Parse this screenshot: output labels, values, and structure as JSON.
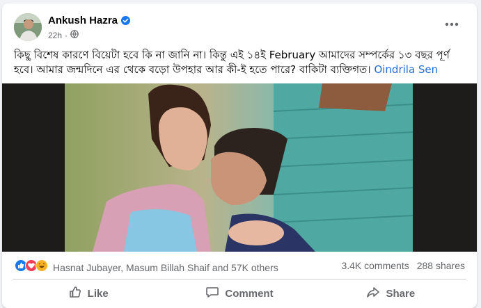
{
  "post": {
    "author": "Ankush Hazra",
    "time": "22h",
    "caption_text": "কিছু বিশেষ কারণে বিয়েটা হবে কি না জানি না। কিন্তু এই ১৪ই February আমাদের সম্পর্কের ১৩ বছর পূর্ণ হবে। আমার জন্মদিনে এর থেকে বড়ো উপহার আর কী-ই হতে পারে? বাকিটা ব্যক্তিগত।",
    "tagged": "Oindrila Sen"
  },
  "stats": {
    "reactors": "Hasnat Jubayer, Masum Billah Shaif and 57K others",
    "comments": "3.4K comments",
    "shares": "288 shares"
  },
  "actions": {
    "like": "Like",
    "comment": "Comment",
    "share": "Share"
  },
  "colors": {
    "link": "#216fdb",
    "like_blue": "#1877f2",
    "love_red": "#f33e58",
    "haha_yellow": "#f7b125"
  }
}
